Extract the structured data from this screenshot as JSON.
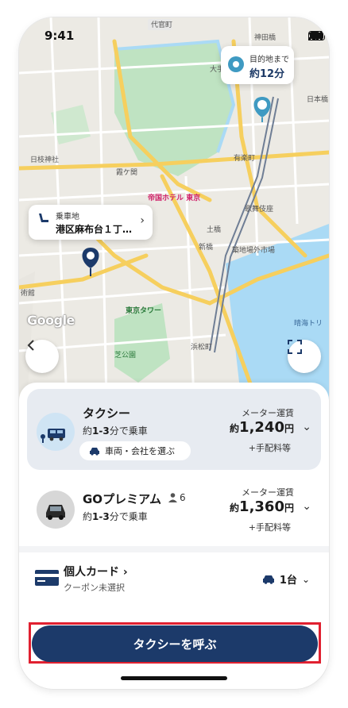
{
  "status_bar": {
    "time": "9:41"
  },
  "map": {
    "destination": {
      "label": "目的地まで",
      "eta": "約12分"
    },
    "pickup": {
      "label": "乗車地",
      "address": "港区麻布台１丁…"
    },
    "place_labels": [
      "代官町",
      "日枝神社",
      "帝国ホテル 東京",
      "歌舞伎座",
      "築地場外市場",
      "東京タワー",
      "芝公園",
      "晴海トリ",
      "術館",
      "土橋",
      "有楽町",
      "霞ケ関",
      "新橋",
      "浜松町",
      "神田橋",
      "大手",
      "日本橋"
    ],
    "attribution": "Google"
  },
  "ride_options": [
    {
      "name": "タクシー",
      "pickup_prefix": "約",
      "pickup_time": "1-3",
      "pickup_suffix": "分で乗車",
      "fare_label": "メーター運賃",
      "fare_prefix": "約",
      "fare": "1,240",
      "fare_unit": "円",
      "fare_note": "+手配料等",
      "selected": true,
      "chip_label": "車両・会社を選ぶ"
    },
    {
      "name": "GOプレミアム",
      "capacity": "6",
      "pickup_prefix": "約",
      "pickup_time": "1-3",
      "pickup_suffix": "分で乗車",
      "fare_label": "メーター運賃",
      "fare_prefix": "約",
      "fare": "1,360",
      "fare_unit": "円",
      "fare_note": "+手配料等",
      "selected": false
    }
  ],
  "payment": {
    "method": "個人カード",
    "coupon": "クーポン未選択",
    "car_count": "1台"
  },
  "cta": {
    "label": "タクシーを呼ぶ"
  },
  "colors": {
    "brand_navy": "#1c3a6a",
    "highlight_red": "#e02030",
    "selected_bg": "#e7ebf1",
    "park_green": "#bfe3c2",
    "water_blue": "#aadaf5",
    "road_yellow": "#f6cf5e"
  },
  "icons": [
    "signal-icon",
    "wifi-icon",
    "battery-icon",
    "location-target-icon",
    "pin-icon",
    "seat-icon",
    "back-icon",
    "fullscreen-icon",
    "taxi-icon",
    "car-icon",
    "person-icon",
    "chevron-down-icon",
    "card-icon",
    "chevron-right-icon"
  ]
}
